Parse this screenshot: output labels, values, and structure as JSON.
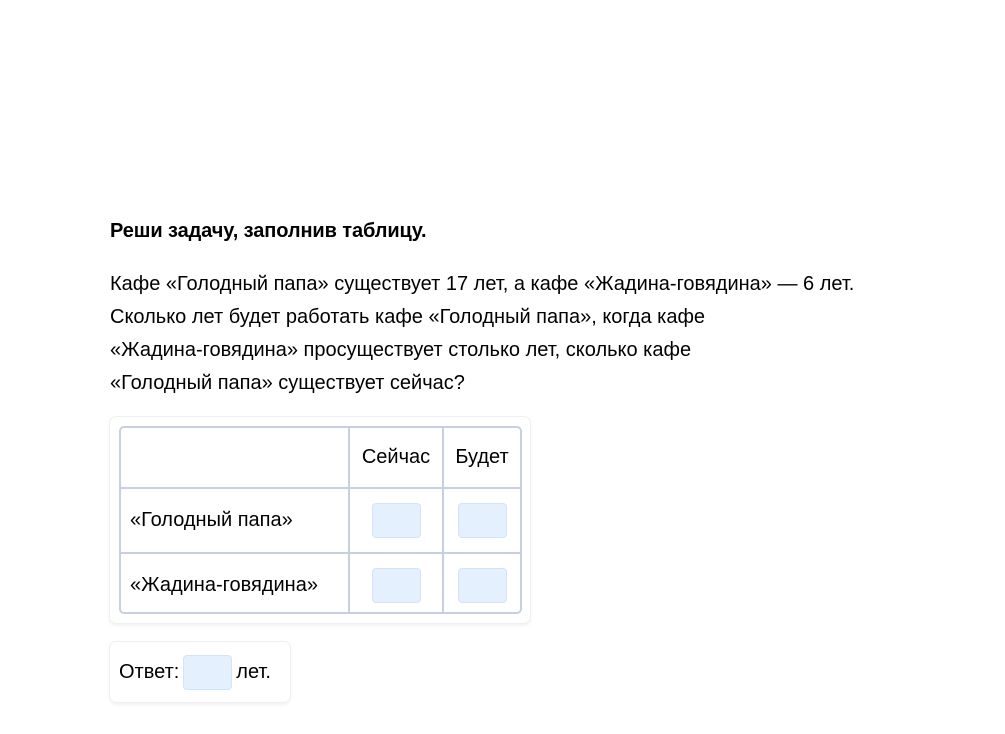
{
  "task": {
    "title": "Реши задачу, заполнив таблицу.",
    "text_lines": [
      "Кафе «Голодный папа» существует 17 лет, а кафе «Жадина-говядина» — 6 лет.",
      "Сколько лет будет работать кафе «Голодный папа», когда кафе",
      "«Жадина-говядина» просуществует столько лет, сколько кафе",
      "«Голодный папа» существует сейчас?"
    ]
  },
  "table": {
    "headers": [
      "",
      "Сейчас",
      "Будет"
    ],
    "rows": [
      {
        "label": "«Голодный папа»",
        "now_value": "",
        "future_value": ""
      },
      {
        "label": "«Жадина-говядина»",
        "now_value": "",
        "future_value": ""
      }
    ]
  },
  "answer": {
    "label": "Ответ:",
    "value": "",
    "unit": "лет."
  },
  "colors": {
    "input_fill": "#e4f0fd",
    "table_border": "#c6d0df"
  }
}
